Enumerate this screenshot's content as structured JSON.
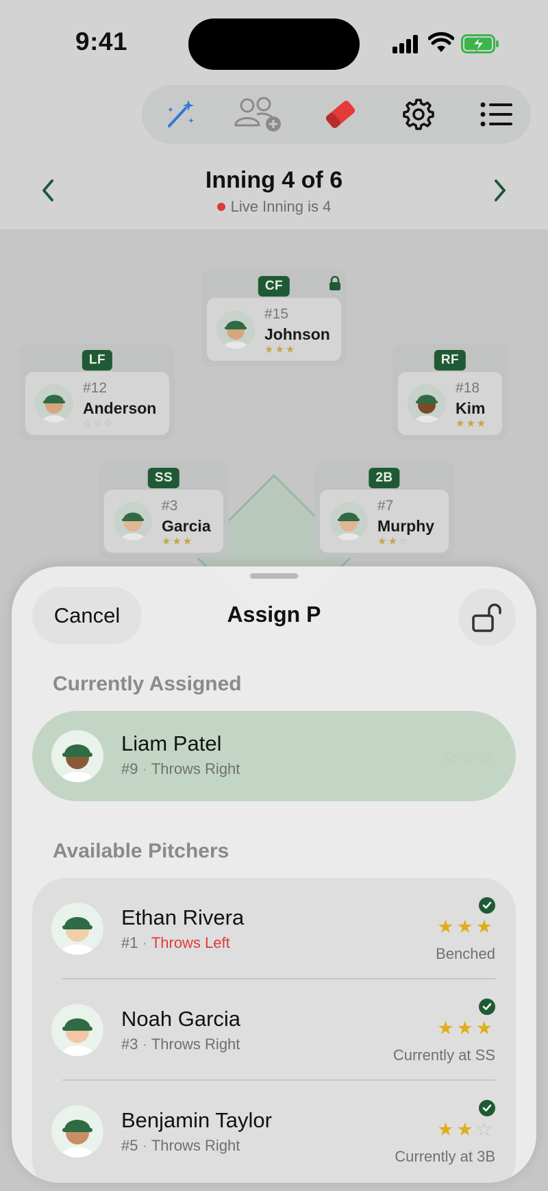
{
  "status_bar": {
    "time": "9:41"
  },
  "toolbar": {
    "buttons": [
      {
        "name": "magic-wand-icon",
        "color": "#2f79d6"
      },
      {
        "name": "add-player-icon",
        "color": "#8a8a8a"
      },
      {
        "name": "eraser-icon",
        "color": "#e43a3a"
      },
      {
        "name": "gear-icon",
        "color": "#111111"
      },
      {
        "name": "list-icon",
        "color": "#111111"
      }
    ]
  },
  "inning": {
    "title": "Inning 4 of 6",
    "live_text": "Live Inning is 4"
  },
  "positions": [
    {
      "code": "CF",
      "number": "#15",
      "name": "Johnson",
      "stars": 3,
      "locked": true
    },
    {
      "code": "LF",
      "number": "#12",
      "name": "Anderson",
      "stars": 0
    },
    {
      "code": "RF",
      "number": "#18",
      "name": "Kim",
      "stars": 3
    },
    {
      "code": "SS",
      "number": "#3",
      "name": "Garcia",
      "stars": 3
    },
    {
      "code": "2B",
      "number": "#7",
      "name": "Murphy",
      "stars": 2
    }
  ],
  "sheet": {
    "cancel_label": "Cancel",
    "title": "Assign P",
    "currently_assigned_label": "Currently Assigned",
    "available_label": "Available Pitchers",
    "assigned": {
      "name": "Liam Patel",
      "number": "#9",
      "throws": "Throws Right",
      "stars": 0
    },
    "pitchers": [
      {
        "name": "Ethan Rivera",
        "number": "#1",
        "throws": "Throws Left",
        "stars": 3,
        "status": "Benched"
      },
      {
        "name": "Noah Garcia",
        "number": "#3",
        "throws": "Throws Right",
        "stars": 3,
        "status": "Currently at SS"
      },
      {
        "name": "Benjamin Taylor",
        "number": "#5",
        "throws": "Throws Right",
        "stars": 2,
        "status": "Currently at 3B"
      }
    ]
  },
  "colors": {
    "team_green": "#1f5a34",
    "star_gold": "#e1ad1c",
    "live_red": "#e03a3a"
  }
}
